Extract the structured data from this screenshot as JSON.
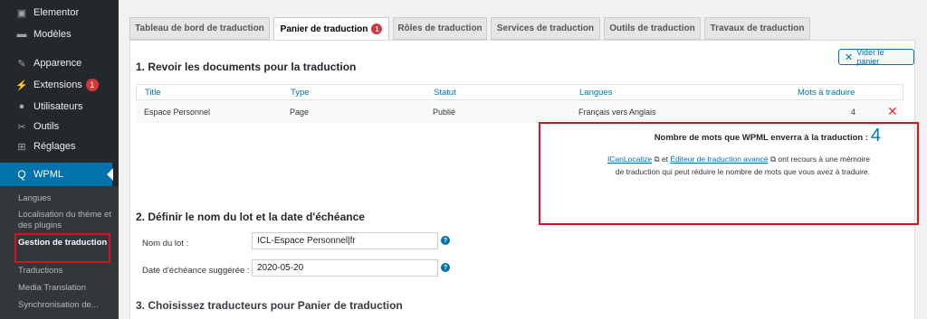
{
  "sidebar": {
    "items": [
      {
        "label": "Elementor",
        "icon": "elementor-icon"
      },
      {
        "label": "Modèles",
        "icon": "folder-icon"
      },
      {
        "label": "Apparence",
        "icon": "paintbrush-icon"
      },
      {
        "label": "Extensions",
        "icon": "plugin-icon",
        "badge": "1"
      },
      {
        "label": "Utilisateurs",
        "icon": "users-icon"
      },
      {
        "label": "Outils",
        "icon": "wrench-icon"
      },
      {
        "label": "Réglages",
        "icon": "settings-icon"
      }
    ],
    "active": {
      "label": "WPML",
      "icon": "wpml-icon"
    },
    "submenu": [
      {
        "label": "Langues"
      },
      {
        "label": "Localisation du thème et des plugins"
      },
      {
        "label": "Gestion de traduction"
      },
      {
        "label": "Traductions"
      },
      {
        "label": "Media Translation"
      },
      {
        "label": "Synchronisation de..."
      }
    ],
    "colors": {
      "bg": "#23282d",
      "active": "#0073aa",
      "highlight": "#d9121f"
    }
  },
  "tabs": [
    {
      "label": "Tableau de bord de traduction"
    },
    {
      "label": "Panier de traduction",
      "badge": "1",
      "active": true
    },
    {
      "label": "Rôles de traduction"
    },
    {
      "label": "Services de traduction"
    },
    {
      "label": "Outils de traduction"
    },
    {
      "label": "Travaux de traduction"
    }
  ],
  "basket": {
    "clear_label": "Vider le panier",
    "section1_title": "1. Revoir les documents pour la traduction",
    "columns": [
      "Title",
      "Type",
      "Statut",
      "Langues",
      "Mots à traduire"
    ],
    "rows": [
      {
        "title": "Espace Personnel",
        "type": "Page",
        "status": "Publié",
        "languages": "Français vers Anglais",
        "words": "4"
      }
    ],
    "word_count": {
      "title": "Nombre de mots que WPML enverra à la traduction :",
      "number": "4",
      "link1": "ICanLocalize",
      "and": "et",
      "link2": "Éditeur de traduction avancé",
      "desc": "ont recours à une mémoire de traduction qui peut réduire le nombre de mots que vous avez à traduire."
    },
    "section2_title": "2. Définir le nom du lot et la date d'échéance",
    "batch_label": "Nom du lot :",
    "batch_value": "ICL-Espace Personnel|fr",
    "deadline_label": "Date d'échéance suggérée :",
    "deadline_value": "2020-05-20",
    "section3_title": "3. Choisissez traducteurs pour Panier de traduction"
  }
}
